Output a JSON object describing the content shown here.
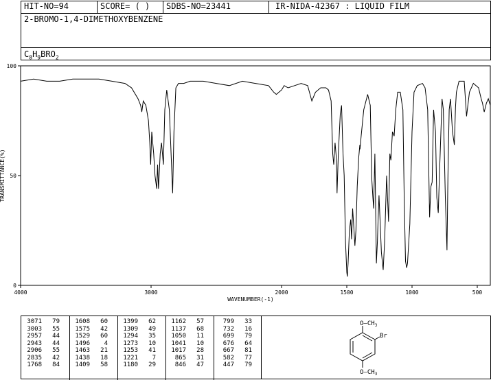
{
  "header": {
    "hit_no": "HIT-NO=94",
    "score": "SCORE=  (  )",
    "sdbs_no": "SDBS-NO=23441",
    "ir_nida": "IR-NIDA-42367 : LIQUID FILM",
    "compound_name": "2-BROMO-1,4-DIMETHOXYBENZENE",
    "formula_prefix": "C",
    "formula_c": "8",
    "formula_h_label": "H",
    "formula_h": "9",
    "formula_rest": "BRO",
    "formula_o": "2"
  },
  "chart_data": {
    "type": "line",
    "title": "",
    "xlabel": "WAVENUMBER(-1)",
    "ylabel": "TRANSMITTANCE(%)",
    "xlim": [
      4000,
      400
    ],
    "ylim": [
      0,
      100
    ],
    "x_ticks": [
      {
        "value": 4000,
        "label": "4000"
      },
      {
        "value": 3000,
        "label": "3000"
      },
      {
        "value": 2000,
        "label": "2000"
      },
      {
        "value": 1500,
        "label": "1500"
      },
      {
        "value": 1000,
        "label": "1000"
      },
      {
        "value": 500,
        "label": "500"
      }
    ],
    "y_ticks": [
      {
        "value": 100,
        "label": "100"
      },
      {
        "value": 50,
        "label": "50"
      },
      {
        "value": 0,
        "label": "0"
      }
    ],
    "series": [
      {
        "x": [
          4000,
          3900,
          3800,
          3700,
          3600,
          3500,
          3400,
          3300,
          3200,
          3150,
          3100,
          3080,
          3071,
          3060,
          3040,
          3020,
          3010,
          3003,
          2995,
          2980,
          2970,
          2957,
          2950,
          2943,
          2930,
          2920,
          2906,
          2895,
          2880,
          2860,
          2850,
          2835,
          2825,
          2810,
          2790,
          2750,
          2700,
          2600,
          2500,
          2400,
          2300,
          2200,
          2100,
          2060,
          2040,
          2020,
          2000,
          1980,
          1950,
          1900,
          1850,
          1800,
          1768,
          1740,
          1700,
          1660,
          1640,
          1620,
          1608,
          1600,
          1590,
          1580,
          1575,
          1565,
          1550,
          1540,
          1529,
          1520,
          1510,
          1500,
          1496,
          1490,
          1480,
          1470,
          1463,
          1455,
          1445,
          1438,
          1430,
          1420,
          1409,
          1400,
          1399,
          1390,
          1370,
          1340,
          1320,
          1309,
          1300,
          1294,
          1285,
          1273,
          1265,
          1260,
          1253,
          1245,
          1235,
          1221,
          1210,
          1195,
          1180,
          1170,
          1162,
          1150,
          1137,
          1125,
          1110,
          1090,
          1070,
          1060,
          1050,
          1041,
          1035,
          1025,
          1017,
          1010,
          1000,
          985,
          960,
          920,
          900,
          880,
          865,
          855,
          846,
          835,
          820,
          810,
          799,
          790,
          770,
          760,
          745,
          732,
          725,
          715,
          705,
          699,
          690,
          676,
          667,
          660,
          640,
          600,
          582,
          560,
          530,
          510,
          490,
          470,
          460,
          447,
          430,
          415,
          400
        ],
        "y": [
          93,
          94,
          93,
          93,
          94,
          94,
          94,
          93,
          92,
          90,
          85,
          82,
          79,
          84,
          82,
          75,
          65,
          55,
          70,
          60,
          50,
          44,
          55,
          44,
          60,
          65,
          55,
          80,
          89,
          80,
          65,
          42,
          70,
          90,
          92,
          92,
          93,
          93,
          92,
          91,
          93,
          92,
          91,
          88,
          87,
          88,
          89,
          91,
          90,
          91,
          92,
          91,
          84,
          88,
          90,
          90,
          89,
          84,
          60,
          55,
          65,
          58,
          42,
          60,
          78,
          82,
          60,
          50,
          20,
          6,
          4,
          10,
          25,
          30,
          21,
          35,
          25,
          18,
          25,
          45,
          58,
          64,
          62,
          68,
          80,
          87,
          82,
          49,
          40,
          35,
          60,
          10,
          20,
          30,
          41,
          30,
          15,
          7,
          20,
          50,
          29,
          60,
          57,
          70,
          68,
          80,
          88,
          88,
          80,
          40,
          11,
          8,
          10,
          20,
          28,
          45,
          70,
          88,
          91,
          92,
          90,
          80,
          31,
          45,
          47,
          80,
          70,
          40,
          33,
          50,
          85,
          80,
          40,
          16,
          50,
          80,
          85,
          79,
          70,
          64,
          81,
          88,
          93,
          93,
          77,
          88,
          92,
          91,
          90,
          85,
          83,
          79,
          83,
          85,
          82
        ]
      }
    ],
    "peaks": [
      [
        "3071",
        "79"
      ],
      [
        "3003",
        "55"
      ],
      [
        "2957",
        "44"
      ],
      [
        "2943",
        "44"
      ],
      [
        "2906",
        "55"
      ],
      [
        "2835",
        "42"
      ],
      [
        "1768",
        "84"
      ],
      [
        "1608",
        "60"
      ],
      [
        "1575",
        "42"
      ],
      [
        "1529",
        "60"
      ],
      [
        "1496",
        "4"
      ],
      [
        "1463",
        "21"
      ],
      [
        "1438",
        "18"
      ],
      [
        "1409",
        "58"
      ],
      [
        "1399",
        "62"
      ],
      [
        "1309",
        "49"
      ],
      [
        "1294",
        "35"
      ],
      [
        "1273",
        "10"
      ],
      [
        "1253",
        "41"
      ],
      [
        "1221",
        "7"
      ],
      [
        "1180",
        "29"
      ],
      [
        "1162",
        "57"
      ],
      [
        "1137",
        "68"
      ],
      [
        "1050",
        "11"
      ],
      [
        "1041",
        "10"
      ],
      [
        "1017",
        "28"
      ],
      [
        "865",
        "31"
      ],
      [
        "846",
        "47"
      ],
      [
        "799",
        "33"
      ],
      [
        "732",
        "16"
      ],
      [
        "699",
        "79"
      ],
      [
        "676",
        "64"
      ],
      [
        "667",
        "81"
      ],
      [
        "582",
        "77"
      ],
      [
        "447",
        "79"
      ]
    ]
  },
  "structure": {
    "top_substituent": "O—CH",
    "top_sub": "3",
    "side_substituent": "Br",
    "bottom_substituent": "O—CH",
    "bottom_sub": "3"
  }
}
